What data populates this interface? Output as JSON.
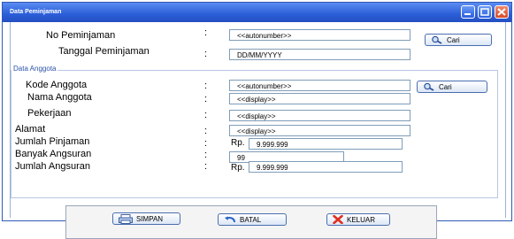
{
  "window": {
    "title": "Data Peminjaman"
  },
  "header_form": {
    "no_peminjaman_label": "No Peminjaman",
    "no_peminjaman_value": "<<autonumber>>",
    "tanggal_label": "Tanggal Peminjaman",
    "tanggal_value": "DD/MM/YYYY",
    "cari_label": "Cari",
    "colon": ":"
  },
  "anggota": {
    "group_label": "Data Anggota",
    "kode_label": "Kode Anggota",
    "kode_value": "<<autonumber>>",
    "cari_label": "Cari",
    "nama_label": "Nama Anggota",
    "nama_value": "<<display>>",
    "pekerjaan_label": "Pekerjaan",
    "pekerjaan_value": "<<display>>",
    "alamat_label": "Alamat",
    "alamat_value": "<<display>>",
    "jumlah_pinjaman_label": "Jumlah Pinjaman",
    "jumlah_pinjaman_currency": "Rp.",
    "jumlah_pinjaman_value": "9.999.999",
    "banyak_angsuran_label": "Banyak Angsuran",
    "banyak_angsuran_value": "99",
    "jumlah_angsuran_label": "Jumlah Angsuran",
    "jumlah_angsuran_currency": "Rp.",
    "jumlah_angsuran_value": "9.999.999"
  },
  "actions": {
    "simpan_label": "SIMPAN",
    "batal_label": "BATAL",
    "keluar_label": "KELUAR"
  },
  "icons": {
    "title_buttons": [
      "minimize-icon",
      "maximize-icon",
      "close-icon"
    ],
    "search": "magnifier-icon",
    "save": "printer-save-icon",
    "cancel": "undo-arrow-icon",
    "exit": "red-x-icon"
  },
  "colors": {
    "titlebar": "#2b5ed8",
    "close_button": "#d84a2a",
    "group_legend": "#2b52a8"
  }
}
